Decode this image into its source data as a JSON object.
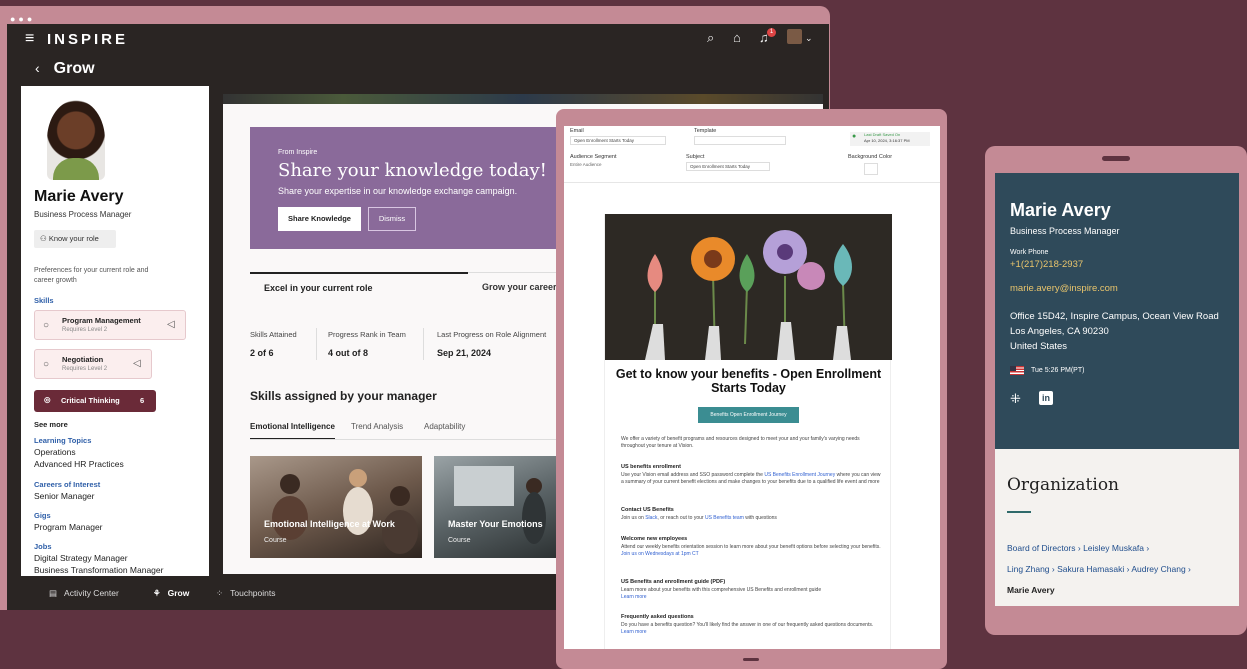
{
  "laptop": {
    "menu_icon": "hamburger-icon",
    "logo": "INSPIRE",
    "back_icon": "chevron-left-icon",
    "page_title": "Grow",
    "notification_count": "1",
    "profile": {
      "name": "Marie Avery",
      "role": "Business Process Manager",
      "know_role_button": "Know your role",
      "preferences_text": "Preferences for your current role and career growth",
      "skills_label": "Skills",
      "skills": [
        {
          "name": "Program Management",
          "requires": "Requires Level 2"
        },
        {
          "name": "Negotiation",
          "requires": "Requires Level 2"
        }
      ],
      "critical_thinking": {
        "name": "Critical Thinking",
        "count": "6"
      },
      "see_more": "See more",
      "learning_topics_label": "Learning Topics",
      "learning_topics": [
        "Operations",
        "Advanced HR Practices"
      ],
      "careers_label": "Careers of Interest",
      "careers": [
        "Senior Manager"
      ],
      "gigs_label": "Gigs",
      "gigs": [
        "Program Manager"
      ],
      "jobs_label": "Jobs",
      "jobs": [
        "Digital Strategy Manager",
        "Business Transformation Manager"
      ]
    },
    "promo": {
      "from": "From Inspire",
      "heading": "Share your knowledge today!",
      "text": "Share your expertise in our knowledge exchange campaign.",
      "primary_button": "Share Knowledge",
      "secondary_button": "Dismiss"
    },
    "role_tabs": [
      "Excel in your current role",
      "Grow your career"
    ],
    "stats": [
      {
        "label": "Skills Attained",
        "value": "2 of 6"
      },
      {
        "label": "Progress Rank in Team",
        "value": "4 out of 8"
      },
      {
        "label": "Last Progress on Role Alignment",
        "value": "Sep 21, 2024"
      }
    ],
    "skills_assigned_title": "Skills assigned by your manager",
    "skill_tabs": [
      "Emotional Intelligence",
      "Trend Analysis",
      "Adaptability"
    ],
    "courses": [
      {
        "title": "Emotional Intelligence at Work",
        "type": "Course"
      },
      {
        "title": "Master Your Emotions",
        "type": "Course"
      }
    ],
    "bottom_nav": [
      "Activity Center",
      "Grow",
      "Touchpoints"
    ]
  },
  "tablet": {
    "editor": {
      "email_label": "Email",
      "email_value": "Open Enrollment Starts Today",
      "template_label": "Template",
      "saved_label": "Last Draft Saved On",
      "saved_value": "Apr 10, 2024, 3:16:37 PM",
      "audience_label": "Audience Segment",
      "audience_value": "Entire Audience",
      "subject_label": "Subject",
      "subject_value": "Open Enrollment Starts Today",
      "bg_label": "Background Color"
    },
    "email": {
      "title": "Get to know your benefits - Open Enrollment Starts Today",
      "button": "Benefits Open Enrollment Journey",
      "intro": "We offer a variety of benefit programs and resources designed to meet your and your family's varying needs throughout your tenure at Vision.",
      "sections": [
        {
          "heading": "US benefits enrollment",
          "body": "Use your Vision email address and SSO password complete the",
          "link": "US Benefits Enrollment Journey",
          "tail": "where you can view a summary of your current benefit elections and make changes to your benefits due to a qualified life event and more"
        },
        {
          "heading": "Contact US Benefits",
          "body": "Join us on",
          "link": "Slack",
          "tail": ", or reach out to your",
          "link2": "US Benefits team",
          "tail2": "with questions"
        },
        {
          "heading": "Welcome new employees",
          "body": "Attend our weekly benefits orientation session to learn more about your benefit options before selecting your benefits.",
          "link": "Join us on Wednesdays at 1pm CT"
        },
        {
          "heading": "US Benefits and enrollment guide (PDF)",
          "body": "Learn more about your benefits with this comprehensive US Benefits and enrollment guide",
          "link": "Learn more"
        },
        {
          "heading": "Frequently asked questions",
          "body": "Do you have a benefits question? You'll likely find the answer in one of our frequently asked questions documents.",
          "link": "Learn more"
        }
      ]
    }
  },
  "phone": {
    "name": "Marie Avery",
    "role": "Business Process Manager",
    "work_phone_label": "Work Phone",
    "work_phone": "+1(217)218-2937",
    "email": "marie.avery@inspire.com",
    "address": [
      "Office 15D42, Inspire Campus, Ocean View Road",
      "Los Angeles, CA 90230",
      "United States"
    ],
    "local_time": "Tue 5:26 PM(PT)",
    "organization_title": "Organization",
    "org_path": [
      "Board of Directors",
      "Leisley Muskafa",
      "Ling Zhang",
      "Sakura Hamasaki",
      "Audrey Chang"
    ],
    "org_current": "Marie Avery"
  },
  "colors": {
    "background": "#5e3340",
    "frame": "#c48a95",
    "promo": "#8a6a9a",
    "phone_header": "#2f4a5a",
    "accent_teal": "#3b8d92"
  }
}
